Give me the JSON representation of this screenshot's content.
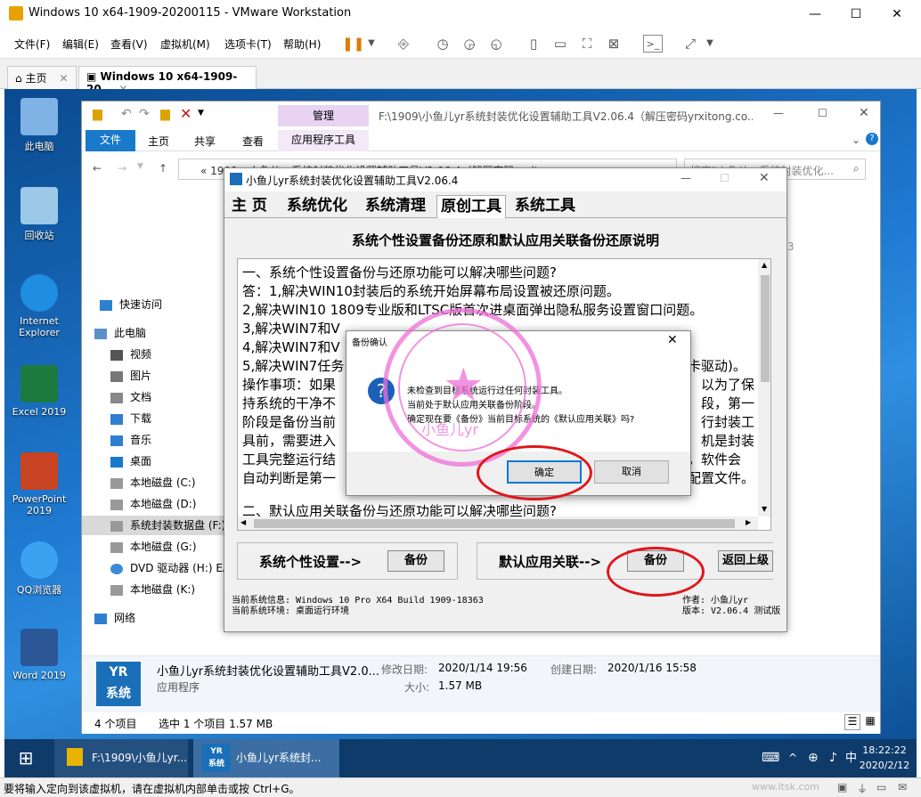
{
  "vm": {
    "title": "Windows 10 x64-1909-20200115 - VMware Workstation",
    "menu": [
      "文件(F)",
      "编辑(E)",
      "查看(V)",
      "虚拟机(M)",
      "选项卡(T)",
      "帮助(H)"
    ],
    "tabs": [
      "主页",
      "Windows 10 x64-1909-20..."
    ],
    "status_text": "要将输入定向到该虚拟机，请在虚拟机内部单击或按 Ctrl+G。",
    "watermark": "www.itsk.com"
  },
  "desktop": {
    "icons": [
      {
        "label": "此电脑",
        "color": "#7fb2e5"
      },
      {
        "label": "回收站",
        "color": "#9cc9e8"
      },
      {
        "label": "Internet Explorer",
        "color": "#1f8de0"
      },
      {
        "label": "Excel 2019",
        "color": "#1d7a3f"
      },
      {
        "label": "PowerPoint 2019",
        "color": "#c84423"
      },
      {
        "label": "QQ浏览器",
        "color": "#3aa2ef"
      },
      {
        "label": "Word 2019",
        "color": "#2b5797"
      }
    ]
  },
  "explorer": {
    "title": "F:\\1909\\小鱼儿yr系统封装优化设置辅助工具V2.06.4（解压密码yrxitong.co...",
    "manage_tab": "管理",
    "ribbon_tabs": [
      "文件",
      "主页",
      "共享",
      "查看",
      "应用程序工具"
    ],
    "address": "«   1909 › 小鱼儿yr系统封装优化设置辅助工具V2.06.4（解压密码yrxitong...",
    "search_placeholder": "搜索\"小鱼儿yr系统封装优化...",
    "nav": [
      "快速访问",
      "此电脑",
      "视频",
      "图片",
      "文档",
      "下载",
      "音乐",
      "桌面",
      "本地磁盘 (C:)",
      "本地磁盘 (D:)",
      "系统封装数据盘 (F:)",
      "本地磁盘 (G:)",
      "DVD 驱动器 (H:) EA",
      "本地磁盘 (K:)",
      "网络"
    ],
    "detail": {
      "name": "小鱼儿yr系统封装优化设置辅助工具V2.0...",
      "type": "应用程序",
      "mod_label": "修改日期:",
      "mod_value": "2020/1/14 19:56",
      "created_label": "创建日期:",
      "created_value": "2020/1/16 15:58",
      "size_label": "大小:",
      "size_value": "1.57 MB"
    },
    "status_count": "4 个项目",
    "status_selected": "选中 1 个项目  1.57 MB"
  },
  "app": {
    "title": "小鱼儿yr系统封装优化设置辅助工具V2.06.4",
    "tabs": [
      "主 页",
      "系统优化",
      "系统清理",
      "原创工具",
      "系统工具"
    ],
    "heading": "系统个性设置备份还原和默认应用关联备份还原说明",
    "lines": [
      "一、系统个性设置备份与还原功能可以解决哪些问题?",
      "答：1,解决WIN10封装后的系统开始屏幕布局设置被还原问题。",
      "2,解决WIN10 1809专业版和LTSC版首次进桌面弹出隐私服务设置窗口问题。",
      "3,解决WIN7和V",
      "4,解决WIN7和V",
      "5,解决WIN7任务",
      "操作事项：如果",
      "持系统的干净不",
      "阶段是备份当前",
      "具前，需要进入",
      "工具完整运行结",
      "自动判断是第一",
      "",
      "二、默认应用关联备份与还原功能可以解决哪些问题?"
    ],
    "right_fragments": [
      "卡驱动)。",
      "以为了保",
      "段，第一",
      "行封装工",
      "机是封装",
      "，软件会",
      "配置文件。"
    ],
    "personal_label": "系统个性设置-->",
    "backup_label": "备份",
    "default_label": "默认应用关联-->",
    "back_label": "返回上级",
    "sysinfo": "当前系统信息: Windows 10 Pro X64 Build 1909-18363",
    "env": "当前系统环境: 桌面运行环境",
    "author": "作者: 小鱼儿yr",
    "version": "版本: V2.06.4 测试版"
  },
  "dialog": {
    "title": "备份确认",
    "msg1": "未检查到目标系统运行过任何封装工具。",
    "msg2": "当前处于默认应用关联备份阶段。",
    "msg3": "确定现在要《备份》当前目标系统的《默认应用关联》吗?",
    "ok": "确定",
    "cancel": "取消"
  },
  "stamp": {
    "text": "小鱼儿yr"
  },
  "taskbar": {
    "item1": "F:\\1909\\小鱼儿yr...",
    "item2": "小鱼儿yr系统封...",
    "ime": "中",
    "time": "18:22:22",
    "date": "2020/2/12"
  }
}
